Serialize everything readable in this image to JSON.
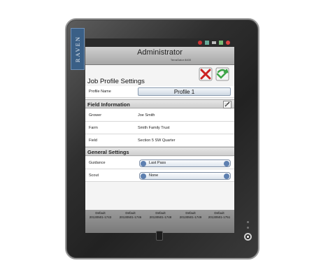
{
  "device": {
    "brand": "RAVEN"
  },
  "header": {
    "title": "Administrator",
    "subtitle": "TerraGator 8400"
  },
  "screen_title": "Job Profile Settings",
  "profile": {
    "label": "Profile Name",
    "button": "Profile 1"
  },
  "field_info": {
    "title": "Field Information",
    "rows": [
      {
        "label": "Grower",
        "value": "Joe Smith"
      },
      {
        "label": "Farm",
        "value": "Smith Family Trust"
      },
      {
        "label": "Field",
        "value": "Section 5 SW Quarter"
      }
    ]
  },
  "general": {
    "title": "General Settings",
    "rows": [
      {
        "label": "Guidance",
        "value": "Last Pass"
      },
      {
        "label": "Scout",
        "value": "None"
      }
    ]
  },
  "footer": [
    {
      "line1": "Default",
      "line2": "20130501-1743"
    },
    {
      "line1": "Default",
      "line2": "20130501-1746"
    },
    {
      "line1": "Default",
      "line2": "20130501-1748"
    },
    {
      "line1": "Default",
      "line2": "20130501-1749"
    },
    {
      "line1": "Default",
      "line2": "20130501-1751"
    }
  ],
  "colors": {
    "accent": "#3a5f86",
    "cancel": "#cc2222",
    "accept": "#3da447"
  }
}
